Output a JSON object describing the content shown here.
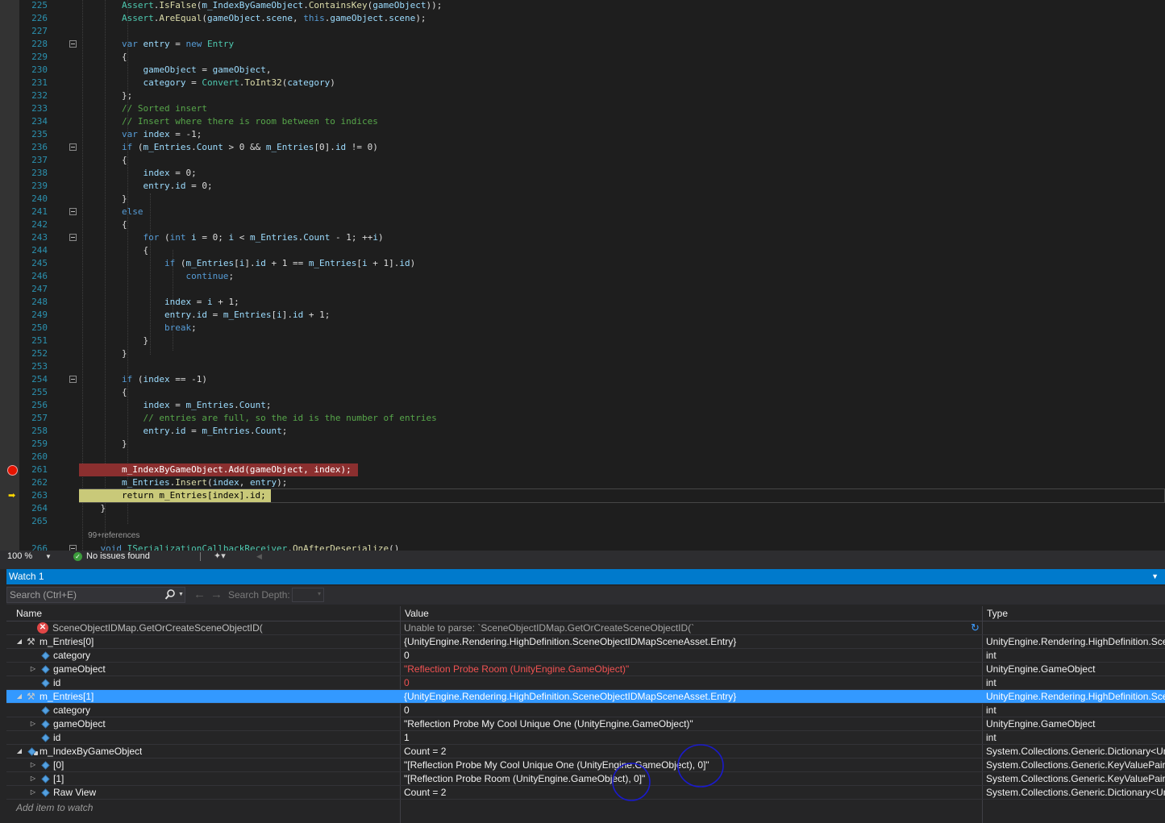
{
  "editor": {
    "lines": [
      {
        "n": "225",
        "text": "        Assert.IsFalse(m_IndexByGameObject.ContainsKey(gameObject));",
        "fold": false
      },
      {
        "n": "226",
        "text": "        Assert.AreEqual(gameObject.scene, this.gameObject.scene);",
        "fold": false
      },
      {
        "n": "227",
        "text": "",
        "fold": false
      },
      {
        "n": "228",
        "text": "        var entry = new Entry",
        "fold": true
      },
      {
        "n": "229",
        "text": "        {",
        "fold": false
      },
      {
        "n": "230",
        "text": "            gameObject = gameObject,",
        "fold": false
      },
      {
        "n": "231",
        "text": "            category = Convert.ToInt32(category)",
        "fold": false
      },
      {
        "n": "232",
        "text": "        };",
        "fold": false
      },
      {
        "n": "233",
        "text": "        // Sorted insert",
        "fold": false
      },
      {
        "n": "234",
        "text": "        // Insert where there is room between to indices",
        "fold": false
      },
      {
        "n": "235",
        "text": "        var index = -1;",
        "fold": false
      },
      {
        "n": "236",
        "text": "        if (m_Entries.Count > 0 && m_Entries[0].id != 0)",
        "fold": true
      },
      {
        "n": "237",
        "text": "        {",
        "fold": false
      },
      {
        "n": "238",
        "text": "            index = 0;",
        "fold": false
      },
      {
        "n": "239",
        "text": "            entry.id = 0;",
        "fold": false
      },
      {
        "n": "240",
        "text": "        }",
        "fold": false
      },
      {
        "n": "241",
        "text": "        else",
        "fold": true
      },
      {
        "n": "242",
        "text": "        {",
        "fold": false
      },
      {
        "n": "243",
        "text": "            for (int i = 0; i < m_Entries.Count - 1; ++i)",
        "fold": true
      },
      {
        "n": "244",
        "text": "            {",
        "fold": false
      },
      {
        "n": "245",
        "text": "                if (m_Entries[i].id + 1 == m_Entries[i + 1].id)",
        "fold": false
      },
      {
        "n": "246",
        "text": "                    continue;",
        "fold": false
      },
      {
        "n": "247",
        "text": "",
        "fold": false
      },
      {
        "n": "248",
        "text": "                index = i + 1;",
        "fold": false
      },
      {
        "n": "249",
        "text": "                entry.id = m_Entries[i].id + 1;",
        "fold": false
      },
      {
        "n": "250",
        "text": "                break;",
        "fold": false
      },
      {
        "n": "251",
        "text": "            }",
        "fold": false
      },
      {
        "n": "252",
        "text": "        }",
        "fold": false
      },
      {
        "n": "253",
        "text": "",
        "fold": false
      },
      {
        "n": "254",
        "text": "        if (index == -1)",
        "fold": true
      },
      {
        "n": "255",
        "text": "        {",
        "fold": false
      },
      {
        "n": "256",
        "text": "            index = m_Entries.Count;",
        "fold": false
      },
      {
        "n": "257",
        "text": "            // entries are full, so the id is the number of entries",
        "fold": false
      },
      {
        "n": "258",
        "text": "            entry.id = m_Entries.Count;",
        "fold": false
      },
      {
        "n": "259",
        "text": "        }",
        "fold": false
      },
      {
        "n": "260",
        "text": "",
        "fold": false
      },
      {
        "n": "261",
        "text": "        m_IndexByGameObject.Add(gameObject, index);",
        "fold": false,
        "breakpoint": true
      },
      {
        "n": "262",
        "text": "        m_Entries.Insert(index, entry);",
        "fold": false
      },
      {
        "n": "263",
        "text": "        return m_Entries[index].id;",
        "fold": false,
        "current": true
      },
      {
        "n": "264",
        "text": "    }",
        "fold": false
      },
      {
        "n": "265",
        "text": "",
        "fold": false
      },
      {
        "n": "",
        "text": "    99+references",
        "fold": false,
        "codelens": true
      },
      {
        "n": "266",
        "text": "    void ISerializationCallbackReceiver.OnAfterDeserialize()",
        "fold": true
      }
    ]
  },
  "status_bar": {
    "zoom": "100 %",
    "issues": "No issues found"
  },
  "watch": {
    "title": "Watch 1",
    "search_placeholder": "Search (Ctrl+E)",
    "depth_label": "Search Depth:",
    "columns": {
      "name": "Name",
      "value": "Value",
      "type": "Type"
    },
    "rows": [
      {
        "name": "SceneObjectIDMap.GetOrCreateSceneObjectID(",
        "value": "Unable to parse: `SceneObjectIDMap.GetOrCreateSceneObjectID(`",
        "type": "",
        "level": 0,
        "icon": "error",
        "expander": ""
      },
      {
        "name": "m_Entries[0]",
        "value": "{UnityEngine.Rendering.HighDefinition.SceneObjectIDMapSceneAsset.Entry}",
        "type": "UnityEngine.Rendering.HighDefinition.SceneObjectIDMapSceneAsset.Entry",
        "level": 0,
        "icon": "wrench",
        "expander": "open"
      },
      {
        "name": "category",
        "value": "0",
        "type": "int",
        "level": 1,
        "icon": "field",
        "expander": ""
      },
      {
        "name": "gameObject",
        "value": "\"Reflection Probe Room (UnityEngine.GameObject)\"",
        "type": "UnityEngine.GameObject",
        "level": 1,
        "icon": "field",
        "expander": "closed",
        "changed": true
      },
      {
        "name": "id",
        "value": "0",
        "type": "int",
        "level": 1,
        "icon": "field",
        "expander": "",
        "changed": true
      },
      {
        "name": "m_Entries[1]",
        "value": "{UnityEngine.Rendering.HighDefinition.SceneObjectIDMapSceneAsset.Entry}",
        "type": "UnityEngine.Rendering.HighDefinition.SceneObjectIDMapSceneAsset.Entry",
        "level": 0,
        "icon": "wrench",
        "expander": "open",
        "selected": true
      },
      {
        "name": "category",
        "value": "0",
        "type": "int",
        "level": 1,
        "icon": "field",
        "expander": ""
      },
      {
        "name": "gameObject",
        "value": "\"Reflection Probe My Cool Unique One (UnityEngine.GameObject)\"",
        "type": "UnityEngine.GameObject",
        "level": 1,
        "icon": "field",
        "expander": "closed"
      },
      {
        "name": "id",
        "value": "1",
        "type": "int",
        "level": 1,
        "icon": "field",
        "expander": ""
      },
      {
        "name": "m_IndexByGameObject",
        "value": "Count = 2",
        "type": "System.Collections.Generic.Dictionary<UnityEngine.GameObject, int>",
        "level": 0,
        "icon": "lockfield",
        "expander": "open"
      },
      {
        "name": "[0]",
        "value": "\"[Reflection Probe My Cool Unique One (UnityEngine.GameObject), 0]\"",
        "type": "System.Collections.Generic.KeyValuePair<UnityEngine.GameObject, int>",
        "level": 1,
        "icon": "field",
        "expander": "closed"
      },
      {
        "name": "[1]",
        "value": "\"[Reflection Probe Room (UnityEngine.GameObject), 0]\"",
        "type": "System.Collections.Generic.KeyValuePair<UnityEngine.GameObject, int>",
        "level": 1,
        "icon": "field",
        "expander": "closed"
      },
      {
        "name": "Raw View",
        "value": "Count = 2",
        "type": "System.Collections.Generic.Dictionary<UnityEngine.GameObject, int>",
        "level": 1,
        "icon": "field",
        "expander": "closed"
      }
    ],
    "add_item_placeholder": "Add item to watch"
  },
  "colors": {
    "accent": "#007acc",
    "selection": "#3399ff",
    "breakpoint": "#8b2f2f",
    "current_line": "#c9c979",
    "changed_value": "#f05252",
    "annotation_circle": "#1a1acc"
  }
}
